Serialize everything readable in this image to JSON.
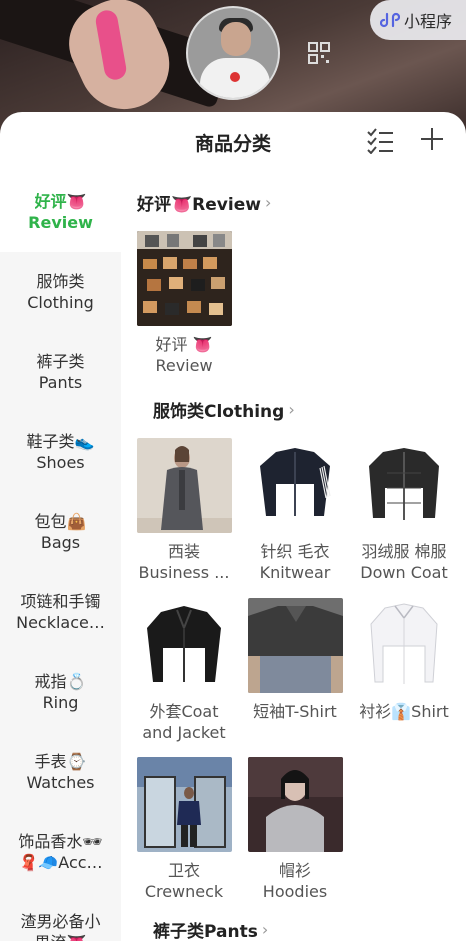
{
  "miniprogram": {
    "label": "小程序"
  },
  "sheet": {
    "title": "商品分类"
  },
  "sidebar": {
    "items": [
      {
        "line1": "好评👅",
        "line2": "Review"
      },
      {
        "line1": "服饰类",
        "line2": "Clothing"
      },
      {
        "line1": "裤子类",
        "line2": "Pants"
      },
      {
        "line1": "鞋子类👟",
        "line2": "Shoes"
      },
      {
        "line1": "包包👜",
        "line2": "Bags"
      },
      {
        "line1": "项链和手镯",
        "line2": "Necklace…"
      },
      {
        "line1": "戒指💍",
        "line2": "Ring"
      },
      {
        "line1": "手表⌚",
        "line2": "Watches"
      },
      {
        "line1": "饰品香水🕶",
        "line2": "🧣🧢Acc…"
      },
      {
        "line1": "渣男必备小",
        "line2": "男流👅"
      }
    ]
  },
  "sections": {
    "review": {
      "title": "好评👅Review",
      "chev": "›"
    },
    "clothing": {
      "title": "服饰类Clothing",
      "chev": "›"
    },
    "pants": {
      "title": "裤子类Pants",
      "chev": "›"
    }
  },
  "tiles": {
    "review": {
      "line1": "好评 👅",
      "line2": "Review"
    },
    "business": {
      "line1": "西装",
      "line2": "Business ..."
    },
    "knit": {
      "line1": "针织 毛衣",
      "line2": "Knitwear"
    },
    "down": {
      "line1": "羽绒服 棉服",
      "line2": "Down Coat"
    },
    "coat": {
      "line1": "外套Coat",
      "line2": "and Jacket"
    },
    "tshirt": {
      "line1": "短袖T-Shirt",
      "line2": ""
    },
    "shirt": {
      "line1": "衬衫👔Shirt",
      "line2": ""
    },
    "crew": {
      "line1": "卫衣",
      "line2": "Crewneck"
    },
    "hoodie": {
      "line1": "帽衫",
      "line2": "Hoodies"
    }
  },
  "colors": {
    "accent": "#2fb34a"
  }
}
